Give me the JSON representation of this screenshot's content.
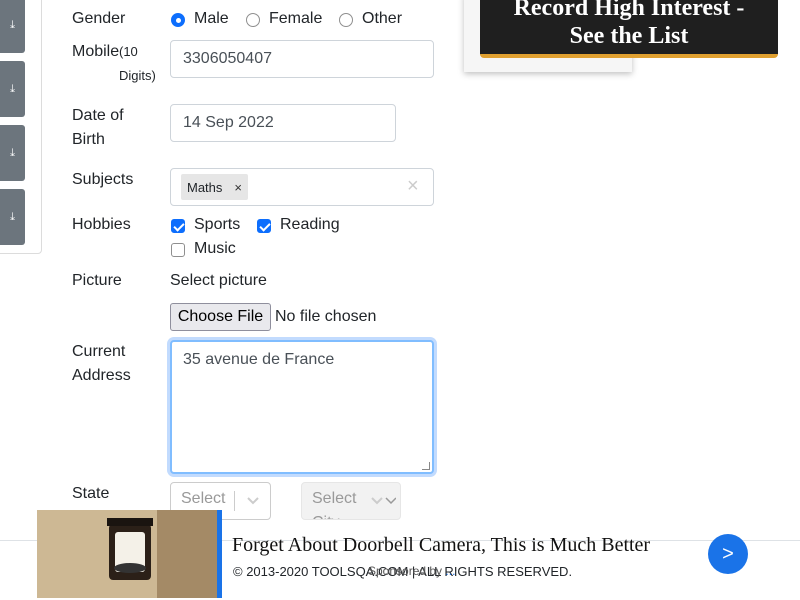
{
  "sidebar": {
    "download_icon": "⤓"
  },
  "form": {
    "gender": {
      "label": "Gender",
      "options": [
        "Male",
        "Female",
        "Other"
      ],
      "selected": "Male"
    },
    "mobile": {
      "label": "Mobile",
      "hint": "(10 Digits)",
      "value": "3306050407"
    },
    "dob": {
      "label_line1": "Date of",
      "label_line2": "Birth",
      "value": "14 Sep 2022"
    },
    "subjects": {
      "label": "Subjects",
      "chips": [
        "Maths"
      ],
      "remove_glyph": "×",
      "clear_glyph": "×"
    },
    "hobbies": {
      "label": "Hobbies",
      "items": [
        {
          "label": "Sports",
          "checked": true
        },
        {
          "label": "Reading",
          "checked": true
        },
        {
          "label": "Music",
          "checked": false
        }
      ]
    },
    "picture": {
      "label": "Picture",
      "caption": "Select picture",
      "button": "Choose File",
      "status": "No file chosen"
    },
    "address": {
      "label_line1": "Current",
      "label_line2": "Address",
      "value": "35 avenue de France"
    },
    "state": {
      "label": "State",
      "placeholder": "Select State"
    },
    "city": {
      "placeholder": "Select City"
    }
  },
  "top_ad": {
    "line1": "Record High Interest -",
    "line2": "See the List"
  },
  "footer": {
    "copyright": "© 2013-2020 TOOLSQA.COM | ALL RIGHTS RESERVED."
  },
  "bottom_ad": {
    "headline": "Forget About Doorbell Camera, This is Much Better",
    "sponsor_prefix": "Sponsored by",
    "sponsor_name": "...",
    "next_label": ">"
  },
  "colors": {
    "accent": "#0d6efd",
    "ad_accent": "#1a73e8",
    "sidebar_button": "#6c757d"
  }
}
